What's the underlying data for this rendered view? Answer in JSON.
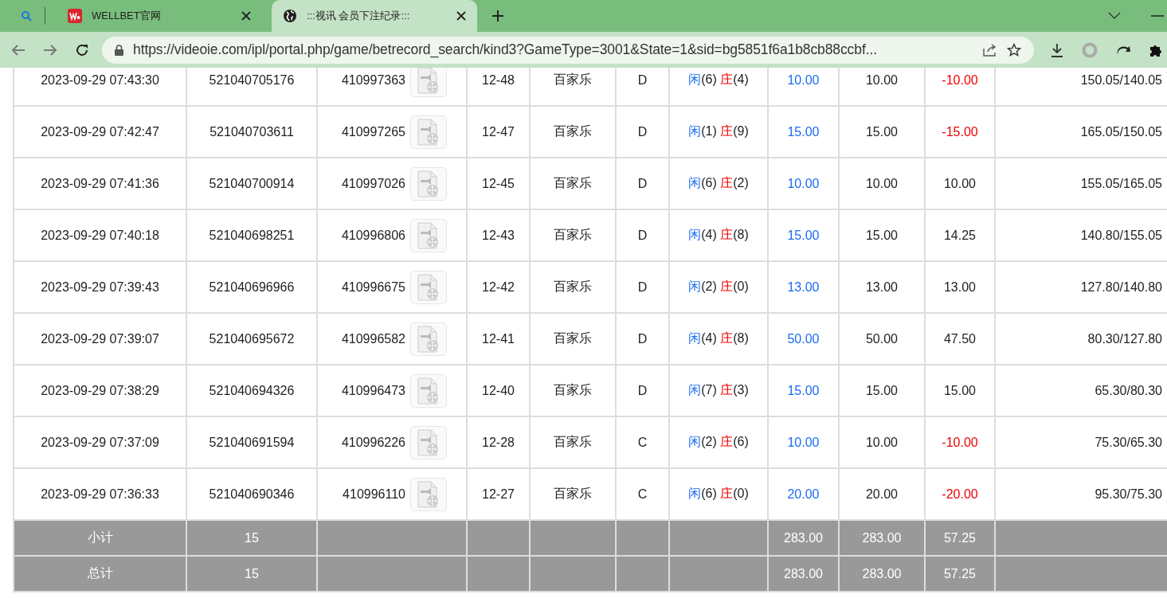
{
  "browser": {
    "tabs": [
      {
        "title": "WELLBET官网",
        "selected": false,
        "kind": "logo"
      },
      {
        "title": ":::视讯 会员下注纪录:::",
        "selected": true,
        "kind": "globe"
      }
    ],
    "address": "https://videoie.com/ipl/portal.php/game/betrecord_search/kind3?GameType=3001&State=1&sid=bg5851f6a1b8cb88ccbf..."
  },
  "table": {
    "rows": [
      {
        "time": "2023-09-29 07:43:30",
        "bet_no": "521040705176",
        "round_no": "410997363",
        "shoe": "12-48",
        "game": "百家乐",
        "table": "D",
        "player_label": "闲",
        "player": "(6)",
        "banker_label": "庄",
        "banker": "(4)",
        "bet": "10.00",
        "valid": "10.00",
        "win": "-10.00",
        "negative": true,
        "balance": "150.05/140.05"
      },
      {
        "time": "2023-09-29 07:42:47",
        "bet_no": "521040703611",
        "round_no": "410997265",
        "shoe": "12-47",
        "game": "百家乐",
        "table": "D",
        "player_label": "闲",
        "player": "(1)",
        "banker_label": "庄",
        "banker": "(9)",
        "bet": "15.00",
        "valid": "15.00",
        "win": "-15.00",
        "negative": true,
        "balance": "165.05/150.05"
      },
      {
        "time": "2023-09-29 07:41:36",
        "bet_no": "521040700914",
        "round_no": "410997026",
        "shoe": "12-45",
        "game": "百家乐",
        "table": "D",
        "player_label": "闲",
        "player": "(6)",
        "banker_label": "庄",
        "banker": "(2)",
        "bet": "10.00",
        "valid": "10.00",
        "win": "10.00",
        "negative": false,
        "balance": "155.05/165.05"
      },
      {
        "time": "2023-09-29 07:40:18",
        "bet_no": "521040698251",
        "round_no": "410996806",
        "shoe": "12-43",
        "game": "百家乐",
        "table": "D",
        "player_label": "闲",
        "player": "(4)",
        "banker_label": "庄",
        "banker": "(8)",
        "bet": "15.00",
        "valid": "15.00",
        "win": "14.25",
        "negative": false,
        "balance": "140.80/155.05"
      },
      {
        "time": "2023-09-29 07:39:43",
        "bet_no": "521040696966",
        "round_no": "410996675",
        "shoe": "12-42",
        "game": "百家乐",
        "table": "D",
        "player_label": "闲",
        "player": "(2)",
        "banker_label": "庄",
        "banker": "(0)",
        "bet": "13.00",
        "valid": "13.00",
        "win": "13.00",
        "negative": false,
        "balance": "127.80/140.80"
      },
      {
        "time": "2023-09-29 07:39:07",
        "bet_no": "521040695672",
        "round_no": "410996582",
        "shoe": "12-41",
        "game": "百家乐",
        "table": "D",
        "player_label": "闲",
        "player": "(4)",
        "banker_label": "庄",
        "banker": "(8)",
        "bet": "50.00",
        "valid": "50.00",
        "win": "47.50",
        "negative": false,
        "balance": "80.30/127.80"
      },
      {
        "time": "2023-09-29 07:38:29",
        "bet_no": "521040694326",
        "round_no": "410996473",
        "shoe": "12-40",
        "game": "百家乐",
        "table": "D",
        "player_label": "闲",
        "player": "(7)",
        "banker_label": "庄",
        "banker": "(3)",
        "bet": "15.00",
        "valid": "15.00",
        "win": "15.00",
        "negative": false,
        "balance": "65.30/80.30"
      },
      {
        "time": "2023-09-29 07:37:09",
        "bet_no": "521040691594",
        "round_no": "410996226",
        "shoe": "12-28",
        "game": "百家乐",
        "table": "C",
        "player_label": "闲",
        "player": "(2)",
        "banker_label": "庄",
        "banker": "(6)",
        "bet": "10.00",
        "valid": "10.00",
        "win": "-10.00",
        "negative": true,
        "balance": "75.30/65.30"
      },
      {
        "time": "2023-09-29 07:36:33",
        "bet_no": "521040690346",
        "round_no": "410996110",
        "shoe": "12-27",
        "game": "百家乐",
        "table": "C",
        "player_label": "闲",
        "player": "(6)",
        "banker_label": "庄",
        "banker": "(0)",
        "bet": "20.00",
        "valid": "20.00",
        "win": "-20.00",
        "negative": true,
        "balance": "95.30/75.30"
      }
    ],
    "totals": [
      {
        "label": "小计",
        "count": "15",
        "bet": "283.00",
        "valid": "283.00",
        "win": "57.25"
      },
      {
        "label": "总计",
        "count": "15",
        "bet": "283.00",
        "valid": "283.00",
        "win": "57.25"
      }
    ]
  }
}
